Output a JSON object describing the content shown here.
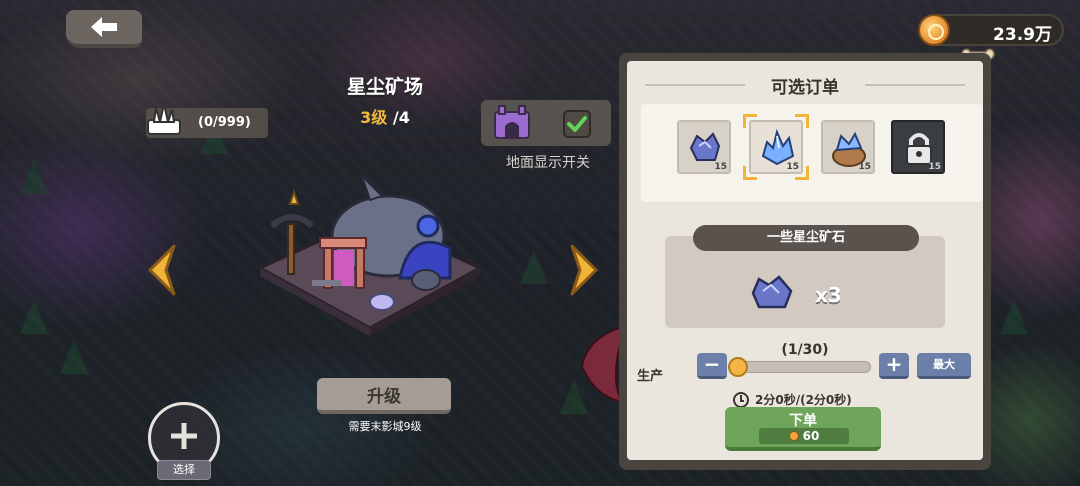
{
  "hud": {
    "coins": "23.9万"
  },
  "building": {
    "name": "星尘矿场",
    "level_current": "3级",
    "level_max": "/4",
    "capacity": "(0/999)",
    "ground_toggle_label": "地面显示开关",
    "ground_toggle_checked": true,
    "upgrade_label": "升级",
    "upgrade_requirement": "需要末影城9级",
    "select_label": "选择"
  },
  "order_panel": {
    "title": "可选订单",
    "slots": [
      {
        "icon": "stardust-ore-small-icon",
        "qty": "15",
        "selected": false,
        "locked": false
      },
      {
        "icon": "stardust-crystal-icon",
        "qty": "15",
        "selected": true,
        "locked": false
      },
      {
        "icon": "crystal-sack-icon",
        "qty": "15",
        "selected": false,
        "locked": true
      },
      {
        "icon": "padlock-icon",
        "qty": "15",
        "selected": false,
        "locked": true
      }
    ],
    "product_name": "一些星尘矿石",
    "product_icon": "stardust-ore-icon",
    "product_qty": "x3",
    "count": "(1/30)",
    "produce_label": "生产",
    "slider_value": 1,
    "slider_max": 30,
    "minus_label": "−",
    "plus_label": "+",
    "max_label": "最大",
    "time": "2分0秒/(2分0秒)",
    "order_button_label": "下单",
    "order_cost": "60"
  },
  "colors": {
    "accent_gold": "#f0b43a",
    "button_green": "#6ea55a",
    "button_blue": "#6b7fa8",
    "panel_bg": "#eae5dd"
  }
}
